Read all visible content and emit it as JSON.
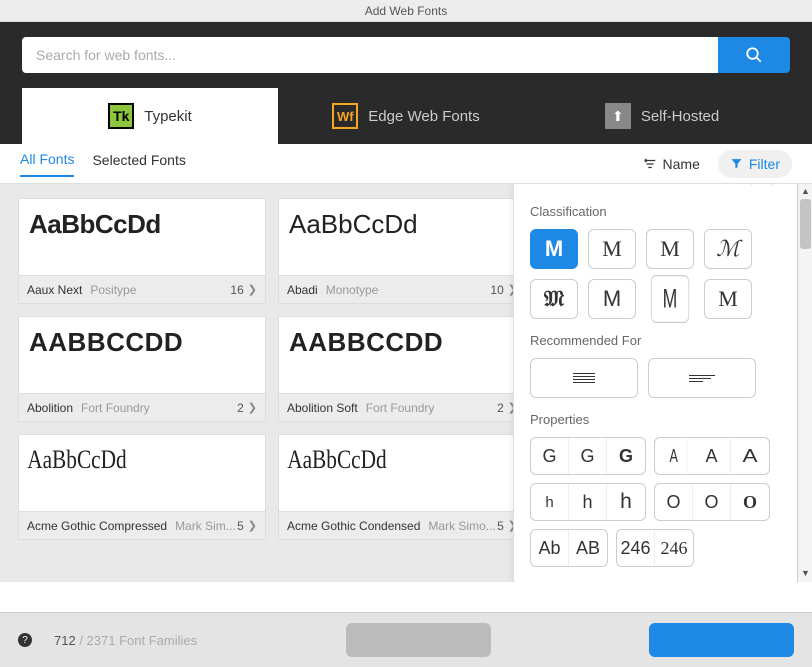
{
  "window": {
    "title": "Add Web Fonts"
  },
  "search": {
    "placeholder": "Search for web fonts..."
  },
  "source_tabs": {
    "typekit": "Typekit",
    "edge": "Edge Web Fonts",
    "self": "Self-Hosted"
  },
  "icons": {
    "typekit": "Tk",
    "edge": "Wf",
    "self_hosted": "⬆"
  },
  "sub_tabs": {
    "all": "All Fonts",
    "selected": "Selected Fonts"
  },
  "toolbar": {
    "sort_label": "Name",
    "filter_label": "Filter"
  },
  "fonts": [
    {
      "preview": "AaBbCcDd",
      "name": "Aaux Next",
      "foundry": "Positype",
      "count": "16",
      "style": "p-aaux"
    },
    {
      "preview": "AaBbCcDd",
      "name": "Abadi",
      "foundry": "Monotype",
      "count": "10",
      "style": "p-abadi"
    },
    {
      "preview": "AABBCCDD",
      "name": "Abolition",
      "foundry": "Fort Foundry",
      "count": "2",
      "style": "p-abolition"
    },
    {
      "preview": "AABBCCDD",
      "name": "Abolition Soft",
      "foundry": "Fort Foundry",
      "count": "2",
      "style": "p-abolition"
    },
    {
      "preview": "AaBbCcDd",
      "name": "Acme Gothic Compressed",
      "foundry": "Mark Sim...",
      "count": "5",
      "style": "p-acme"
    },
    {
      "preview": "AaBbCcDd",
      "name": "Acme Gothic Condensed",
      "foundry": "Mark Simo...",
      "count": "5",
      "style": "p-acme"
    }
  ],
  "filter_panel": {
    "h_class": "Classification",
    "h_rec": "Recommended For",
    "h_prop": "Properties",
    "class_glyphs": [
      "M",
      "M",
      "M",
      "ℳ",
      "𝔐",
      "M",
      "M",
      "M"
    ],
    "prop_g": [
      "G",
      "G",
      "G"
    ],
    "prop_a": [
      "A",
      "A",
      "A"
    ],
    "prop_h": [
      "h",
      "h",
      "h"
    ],
    "prop_o": [
      "O",
      "O",
      "O"
    ],
    "prop_ab": [
      "Ab",
      "AB"
    ],
    "prop_num": [
      "246",
      "246"
    ]
  },
  "footer": {
    "count_visible": "712",
    "count_sep": " / ",
    "count_total": "2371 Font Families"
  }
}
